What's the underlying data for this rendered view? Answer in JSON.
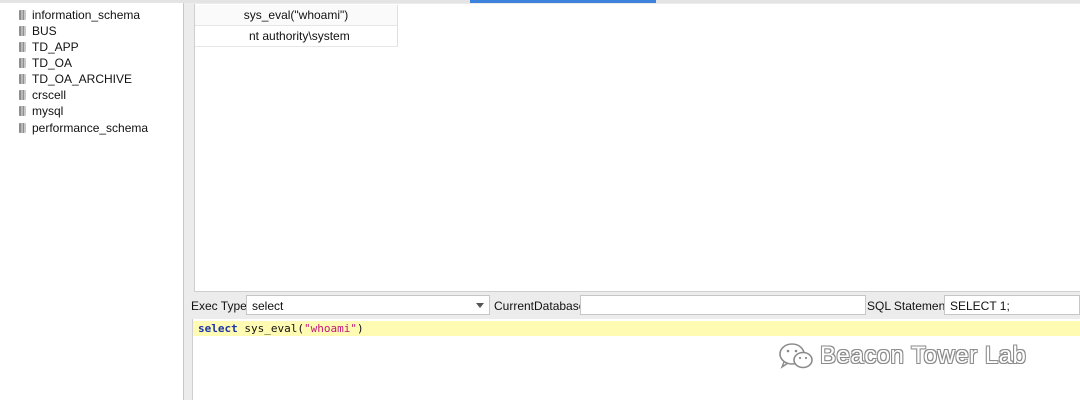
{
  "databases": [
    {
      "name": "information_schema",
      "icon": "database-icon"
    },
    {
      "name": "BUS",
      "icon": "database-icon"
    },
    {
      "name": "TD_APP",
      "icon": "database-icon"
    },
    {
      "name": "TD_OA",
      "icon": "database-icon"
    },
    {
      "name": "TD_OA_ARCHIVE",
      "icon": "database-icon"
    },
    {
      "name": "crscell",
      "icon": "database-icon"
    },
    {
      "name": "mysql",
      "icon": "database-icon"
    },
    {
      "name": "performance_schema",
      "icon": "database-icon"
    }
  ],
  "results": {
    "column_header": "sys_eval(\"whoami\")",
    "rows": [
      "nt authority\\system"
    ]
  },
  "toolbar": {
    "exec_type_label": "Exec Type",
    "exec_type_value": "select",
    "current_db_label": "CurrentDatabase",
    "current_db_value": "",
    "sql_label": "SQL Statement",
    "sql_value": "SELECT 1;"
  },
  "editor": {
    "keyword": "select",
    "function": " sys_eval(",
    "string": "\"whoami\"",
    "close": ")"
  },
  "watermark": {
    "text": "Beacon Tower Lab",
    "icon": "wechat-icon"
  },
  "colors": {
    "active_tab": "#3d83de",
    "editor_highlight": "#fffbb2",
    "keyword": "#1b35a8",
    "string": "#c2187a"
  }
}
